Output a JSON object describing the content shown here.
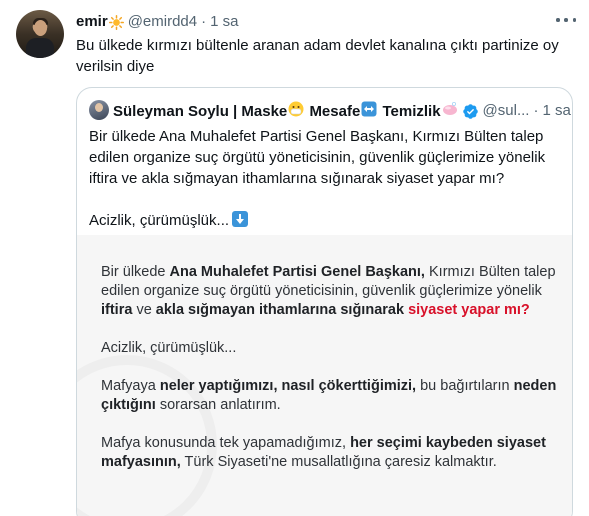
{
  "tweet": {
    "display_name": "emir",
    "name_emoji_icon": "sun-icon",
    "handle": "@emirdd4",
    "separator": "·",
    "time": "1 sa",
    "text": "Bu ülkede kırmızı bültenle aranan adam devlet kanalına çıktı partinize oy verilsin diye"
  },
  "quote": {
    "name_parts": [
      "Süleyman Soylu | Maske",
      "Mesafe",
      "Temizlik"
    ],
    "name_emoji_icons": [
      "mask-face-emoji",
      "left-right-arrow-emoji",
      "soap-emoji",
      "verified-badge-icon"
    ],
    "handle": "@sul...",
    "separator": "·",
    "time": "1 sa",
    "text_line1": "Bir ülkede Ana Muhalefet Partisi Genel Başkanı, Kırmızı Bülten talep edilen organize suç örgütü yöneticisinin, güvenlik güçlerimize yönelik iftira ve akla sığmayan ithamlarına sığınarak siyaset yapar mı?",
    "text_line2": "Acizlik, çürümüşlük...",
    "text_line2_icon": "down-arrow-icon"
  },
  "image_text": {
    "p1_a": "Bir ülkede ",
    "p1_b": "Ana Muhalefet Partisi Genel Başkanı,",
    "p1_c": " Kırmızı Bülten talep edilen organize suç örgütü yöneticisinin, güvenlik güçlerimize yönelik ",
    "p1_d": "iftira",
    "p1_e": " ve ",
    "p1_f": "akla sığmayan ithamlarına sığınarak",
    "p1_g": "siyaset yapar mı?",
    "p2": "Acizlik, çürümüşlük...",
    "p3_a": "Mafyaya ",
    "p3_b": "neler yaptığımızı, nasıl çökerttiğimizi,",
    "p3_c": " bu bağırtıların ",
    "p3_d": "neden çıktığını",
    "p3_e": " sorarsan anlatırım.",
    "p4_a": "Mafya konusunda tek yapamadığımız, ",
    "p4_b": "her seçimi kaybeden siyaset mafyasının,",
    "p4_c": " Türk Siyaseti'ne musallatlığına çaresiz kalmaktır."
  },
  "colors": {
    "text": "#0f1419",
    "secondary": "#536471",
    "border": "#cfd9de",
    "image_red": "#d8112a",
    "verified_blue": "#1d9bf0"
  }
}
